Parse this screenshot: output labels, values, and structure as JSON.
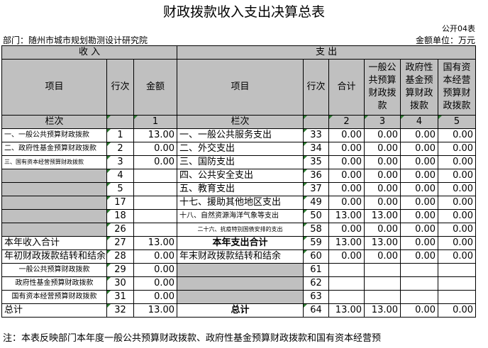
{
  "title": "财政拨款收入支出决算总表",
  "form_no": "公开04表",
  "dept": "部门：随州市城市规划勘测设计研究院",
  "unit": "金额单位：万元",
  "sections": {
    "income": "收        入",
    "expense": "支        出"
  },
  "headers": {
    "item": "项目",
    "line": "行次",
    "amount": "金额",
    "item2": "项目",
    "line2": "行次",
    "total": "合计",
    "gen": "一般公共预算财政拨款",
    "fund": "政府性基金预算财政拨款",
    "state": "国有资本经营预算财政拨款"
  },
  "col_row": {
    "label": "栏次",
    "c1": "1",
    "label2": "栏次",
    "c2": "2",
    "c3": "3",
    "c4": "4",
    "c5": "5"
  },
  "rows": [
    {
      "l": "一、一般公共预算财政拨款",
      "ln": "1",
      "amt": "13.00",
      "r": "一、一般公共服务支出",
      "rn": "33",
      "t": "0.00",
      "g": "0.00",
      "f": "0.00",
      "s": "0.00"
    },
    {
      "l": "二、政府性基金预算财政拨款",
      "ln": "2",
      "amt": "0.00",
      "r": "二、外交支出",
      "rn": "34",
      "t": "0.00",
      "g": "0.00",
      "f": "0.00",
      "s": "0.00"
    },
    {
      "l": "三、国有资本经营预算财政拨款",
      "ln": "3",
      "amt": "0.00",
      "r": "三、国防支出",
      "rn": "35",
      "t": "0.00",
      "g": "0.00",
      "f": "0.00",
      "s": "0.00"
    },
    {
      "l": "",
      "ln": "4",
      "amt": "",
      "r": "四、公共安全支出",
      "rn": "36",
      "t": "0.00",
      "g": "0.00",
      "f": "0.00",
      "s": "0.00"
    },
    {
      "l": "",
      "ln": "5",
      "amt": "",
      "r": "五、教育支出",
      "rn": "37",
      "t": "0.00",
      "g": "0.00",
      "f": "0.00",
      "s": "0.00"
    },
    {
      "l": "",
      "ln": "17",
      "amt": "",
      "r": "十七、援助其他地区支出",
      "rn": "49",
      "t": "0.00",
      "g": "0.00",
      "f": "0.00",
      "s": "0.00"
    },
    {
      "l": "",
      "ln": "18",
      "amt": "",
      "r": "十八、自然资源海洋气象等支出",
      "rn": "50",
      "t": "13.00",
      "g": "13.00",
      "f": "0.00",
      "s": "0.00"
    },
    {
      "l": "",
      "ln": "26",
      "amt": "",
      "r": "二十六、抗疫特别国债安排的支出",
      "rn": "58",
      "t": "0.00",
      "g": "0.00",
      "f": "0.00",
      "s": "0.00"
    },
    {
      "l": "本年收入合计",
      "ln": "27",
      "amt": "13.00",
      "r": "本年支出合计",
      "rn": "59",
      "t": "13.00",
      "g": "13.00",
      "f": "0.00",
      "s": "0.00"
    },
    {
      "l": "年初财政拨款结转和结余",
      "ln": "28",
      "amt": "0.00",
      "r": "年末财政拨款结转和结余",
      "rn": "60",
      "t": "0.00",
      "g": "0.00",
      "f": "0.00",
      "s": "0.00"
    },
    {
      "l": "一般公共预算财政拨款",
      "ln": "29",
      "amt": "0.00",
      "r": "",
      "rn": "61",
      "t": "",
      "g": "",
      "f": "",
      "s": ""
    },
    {
      "l": "政府性基金预算财政拨款",
      "ln": "30",
      "amt": "0.00",
      "r": "",
      "rn": "62",
      "t": "",
      "g": "",
      "f": "",
      "s": ""
    },
    {
      "l": "国有资本经营预算财政拨款",
      "ln": "31",
      "amt": "0.00",
      "r": "",
      "rn": "63",
      "t": "",
      "g": "",
      "f": "",
      "s": ""
    },
    {
      "l": "总计",
      "ln": "32",
      "amt": "13.00",
      "r": "总计",
      "rn": "64",
      "t": "13.00",
      "g": "13.00",
      "f": "0.00",
      "s": "0.00"
    }
  ],
  "note": "注：本表反映部门本年度一般公共预算财政拨款、政府性基金预算财政拨款和国有资本经营预"
}
